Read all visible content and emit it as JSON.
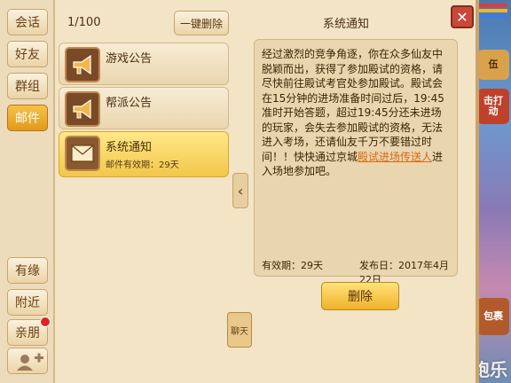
{
  "tabs": {
    "chat": "会话",
    "friends": "好友",
    "groups": "群组",
    "mail": "邮件",
    "fate": "有缘",
    "nearby": "附近",
    "family": "亲朋"
  },
  "mail_list": {
    "count": "1/100",
    "delete_all": "一键删除",
    "items": [
      {
        "title": "游戏公告",
        "sub": ""
      },
      {
        "title": "帮派公告",
        "sub": ""
      },
      {
        "title": "系统通知",
        "sub": "邮件有效期：29天"
      }
    ]
  },
  "detail": {
    "title": "系统通知",
    "body_before": "经过激烈的竞争角逐，你在众多仙友中脱颖而出，获得了参加殿试的资格，请尽快前往殿试考官处参加殿试。殿试会在15分钟的进场准备时间过后，19:45准时开始答题，超过19:45分还未进场的玩家，会失去参加殿试的资格，无法进入考场，还请仙友千万不要错过时间！！快快通过京城",
    "body_link": "殿试进场传送人",
    "body_after": "进入场地参加吧。",
    "validity": "有效期：29天",
    "pubdate": "发布日：2017年4月22日",
    "delete": "删除"
  },
  "colors": {
    "panel": "#f3e4c6",
    "accent": "#f0b22a",
    "link": "#d86a14"
  }
}
